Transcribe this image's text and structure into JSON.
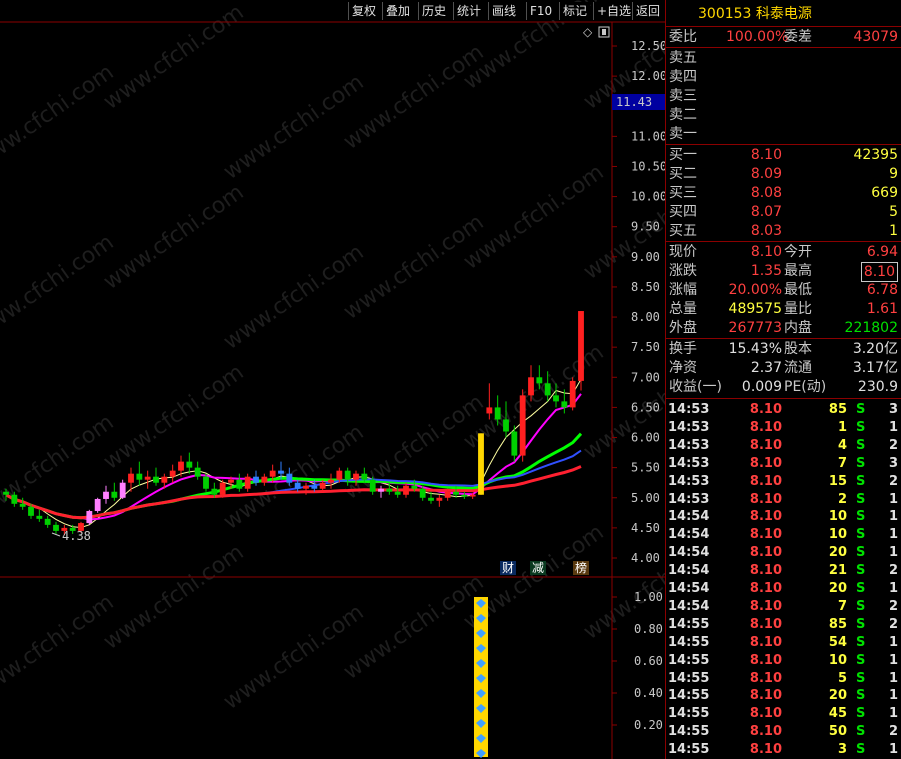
{
  "toolbar": {
    "buttons": [
      "复权",
      "叠加",
      "历史",
      "统计",
      "画线",
      "F10",
      "标记",
      "+自选",
      "返回"
    ]
  },
  "chart": {
    "price_current_label": "11.43",
    "y_ticks": [
      "12.50",
      "12.00",
      "11.50",
      "11.00",
      "10.50",
      "10.00",
      "9.50",
      "9.00",
      "8.50",
      "8.00",
      "7.50",
      "7.00",
      "6.50",
      "6.00",
      "5.50",
      "5.00",
      "4.50",
      "4.00"
    ],
    "low_marker": "4.38",
    "event_tags": [
      "财",
      "减",
      "榜"
    ],
    "sub_y_ticks": [
      "1.00",
      "0.80",
      "0.60",
      "0.40",
      "0.20"
    ],
    "watermark": "www.cfchi.com",
    "colors": {
      "up": "#ff3030",
      "down": "#00e000",
      "ma_green": "#00ff00",
      "ma_blue": "#3050ff",
      "ma_pink": "#ff00ff",
      "ma_red": "#ff2030",
      "limit_up": "#ffd700",
      "axis": "#8b0000"
    }
  },
  "chart_data": {
    "type": "candlestick",
    "y_range": [
      3.8,
      12.8
    ],
    "candles": [
      [
        5.1,
        5.15,
        4.95,
        5.05
      ],
      [
        5.05,
        5.1,
        4.85,
        4.9
      ],
      [
        4.9,
        5.0,
        4.8,
        4.85
      ],
      [
        4.85,
        4.9,
        4.65,
        4.7
      ],
      [
        4.7,
        4.8,
        4.6,
        4.65
      ],
      [
        4.65,
        4.7,
        4.5,
        4.55
      ],
      [
        4.55,
        4.6,
        4.4,
        4.45
      ],
      [
        4.45,
        4.55,
        4.38,
        4.5
      ],
      [
        4.5,
        4.55,
        4.4,
        4.45
      ],
      [
        4.45,
        4.6,
        4.42,
        4.58
      ],
      [
        4.58,
        4.8,
        4.55,
        4.78
      ],
      [
        4.78,
        5.0,
        4.75,
        4.98
      ],
      [
        4.98,
        5.2,
        4.9,
        5.1
      ],
      [
        5.1,
        5.25,
        4.95,
        5.0
      ],
      [
        5.0,
        5.3,
        4.98,
        5.25
      ],
      [
        5.25,
        5.5,
        5.1,
        5.4
      ],
      [
        5.4,
        5.6,
        5.2,
        5.3
      ],
      [
        5.3,
        5.45,
        5.15,
        5.35
      ],
      [
        5.35,
        5.5,
        5.2,
        5.25
      ],
      [
        5.25,
        5.4,
        5.15,
        5.35
      ],
      [
        5.35,
        5.55,
        5.25,
        5.45
      ],
      [
        5.45,
        5.7,
        5.35,
        5.6
      ],
      [
        5.6,
        5.75,
        5.4,
        5.5
      ],
      [
        5.5,
        5.6,
        5.3,
        5.35
      ],
      [
        5.35,
        5.4,
        5.1,
        5.15
      ],
      [
        5.15,
        5.25,
        5.0,
        5.05
      ],
      [
        5.05,
        5.3,
        5.0,
        5.25
      ],
      [
        5.25,
        5.35,
        5.15,
        5.3
      ],
      [
        5.3,
        5.4,
        5.1,
        5.15
      ],
      [
        5.15,
        5.4,
        5.1,
        5.35
      ],
      [
        5.35,
        5.45,
        5.2,
        5.25
      ],
      [
        5.25,
        5.4,
        5.2,
        5.35
      ],
      [
        5.35,
        5.55,
        5.25,
        5.45
      ],
      [
        5.45,
        5.6,
        5.3,
        5.4
      ],
      [
        5.4,
        5.5,
        5.2,
        5.25
      ],
      [
        5.25,
        5.3,
        5.1,
        5.15
      ],
      [
        5.15,
        5.25,
        5.05,
        5.2
      ],
      [
        5.2,
        5.3,
        5.1,
        5.15
      ],
      [
        5.15,
        5.3,
        5.1,
        5.25
      ],
      [
        5.25,
        5.4,
        5.15,
        5.3
      ],
      [
        5.3,
        5.5,
        5.25,
        5.45
      ],
      [
        5.45,
        5.5,
        5.2,
        5.3
      ],
      [
        5.3,
        5.45,
        5.2,
        5.4
      ],
      [
        5.4,
        5.5,
        5.25,
        5.3
      ],
      [
        5.3,
        5.35,
        5.05,
        5.1
      ],
      [
        5.1,
        5.2,
        5.0,
        5.15
      ],
      [
        5.15,
        5.25,
        5.05,
        5.1
      ],
      [
        5.1,
        5.2,
        5.0,
        5.05
      ],
      [
        5.05,
        5.25,
        5.0,
        5.2
      ],
      [
        5.2,
        5.3,
        5.1,
        5.15
      ],
      [
        5.15,
        5.2,
        4.95,
        5.0
      ],
      [
        5.0,
        5.1,
        4.9,
        4.95
      ],
      [
        4.95,
        5.05,
        4.85,
        5.0
      ],
      [
        5.0,
        5.15,
        4.95,
        5.1
      ],
      [
        5.1,
        5.2,
        5.0,
        5.05
      ],
      [
        5.05,
        5.1,
        4.98,
        5.02
      ],
      [
        5.02,
        5.08,
        4.98,
        5.05
      ],
      [
        5.05,
        6.07,
        5.05,
        6.07
      ],
      [
        6.4,
        6.9,
        6.3,
        6.5
      ],
      [
        6.5,
        6.7,
        6.2,
        6.3
      ],
      [
        6.3,
        6.6,
        6.0,
        6.1
      ],
      [
        6.1,
        6.2,
        5.6,
        5.7
      ],
      [
        5.7,
        6.8,
        5.6,
        6.7
      ],
      [
        6.7,
        7.2,
        6.6,
        7.0
      ],
      [
        7.0,
        7.2,
        6.8,
        6.9
      ],
      [
        6.9,
        7.1,
        6.6,
        6.7
      ],
      [
        6.7,
        6.9,
        6.5,
        6.6
      ],
      [
        6.6,
        6.8,
        6.4,
        6.5
      ],
      [
        6.5,
        7.0,
        6.45,
        6.94
      ],
      [
        6.94,
        8.1,
        6.78,
        8.1
      ]
    ],
    "subchart": {
      "type": "bar",
      "series": [
        {
          "values": [
            1.0
          ]
        }
      ]
    }
  },
  "panel": {
    "title": "300153 科泰电源",
    "weibi": {
      "label": "委比",
      "value": "100.00%",
      "diff_label": "委差",
      "diff": "43079"
    },
    "asks": [
      {
        "label": "卖五"
      },
      {
        "label": "卖四"
      },
      {
        "label": "卖三"
      },
      {
        "label": "卖二"
      },
      {
        "label": "卖一"
      }
    ],
    "bids": [
      {
        "label": "买一",
        "price": "8.10",
        "vol": "42395"
      },
      {
        "label": "买二",
        "price": "8.09",
        "vol": "9"
      },
      {
        "label": "买三",
        "price": "8.08",
        "vol": "669"
      },
      {
        "label": "买四",
        "price": "8.07",
        "vol": "5"
      },
      {
        "label": "买五",
        "price": "8.03",
        "vol": "1"
      }
    ],
    "quote": [
      {
        "l1": "现价",
        "v1": "8.10",
        "l2": "今开",
        "v2": "6.94"
      },
      {
        "l1": "涨跌",
        "v1": "1.35",
        "l2": "最高",
        "v2": "8.10"
      },
      {
        "l1": "涨幅",
        "v1": "20.00%",
        "l2": "最低",
        "v2": "6.78"
      },
      {
        "l1": "总量",
        "v1": "489575",
        "l2": "量比",
        "v2": "1.61"
      },
      {
        "l1": "外盘",
        "v1": "267773",
        "l2": "内盘",
        "v2": "221802"
      }
    ],
    "fundamentals": [
      {
        "l1": "换手",
        "v1": "15.43%",
        "l2": "股本",
        "v2": "3.20亿"
      },
      {
        "l1": "净资",
        "v1": "2.37",
        "l2": "流通",
        "v2": "3.17亿"
      },
      {
        "l1": "收益(一)",
        "v1": "0.009",
        "l2": "PE(动)",
        "v2": "230.9"
      }
    ],
    "ticks": [
      [
        "14:53",
        "8.10",
        "85",
        "S",
        "3"
      ],
      [
        "14:53",
        "8.10",
        "1",
        "S",
        "1"
      ],
      [
        "14:53",
        "8.10",
        "4",
        "S",
        "2"
      ],
      [
        "14:53",
        "8.10",
        "7",
        "S",
        "3"
      ],
      [
        "14:53",
        "8.10",
        "15",
        "S",
        "2"
      ],
      [
        "14:53",
        "8.10",
        "2",
        "S",
        "1"
      ],
      [
        "14:54",
        "8.10",
        "10",
        "S",
        "1"
      ],
      [
        "14:54",
        "8.10",
        "10",
        "S",
        "1"
      ],
      [
        "14:54",
        "8.10",
        "20",
        "S",
        "1"
      ],
      [
        "14:54",
        "8.10",
        "21",
        "S",
        "2"
      ],
      [
        "14:54",
        "8.10",
        "20",
        "S",
        "1"
      ],
      [
        "14:54",
        "8.10",
        "7",
        "S",
        "2"
      ],
      [
        "14:55",
        "8.10",
        "85",
        "S",
        "2"
      ],
      [
        "14:55",
        "8.10",
        "54",
        "S",
        "1"
      ],
      [
        "14:55",
        "8.10",
        "10",
        "S",
        "1"
      ],
      [
        "14:55",
        "8.10",
        "5",
        "S",
        "1"
      ],
      [
        "14:55",
        "8.10",
        "20",
        "S",
        "1"
      ],
      [
        "14:55",
        "8.10",
        "45",
        "S",
        "1"
      ],
      [
        "14:55",
        "8.10",
        "50",
        "S",
        "2"
      ],
      [
        "14:55",
        "8.10",
        "3",
        "S",
        "1"
      ]
    ]
  }
}
